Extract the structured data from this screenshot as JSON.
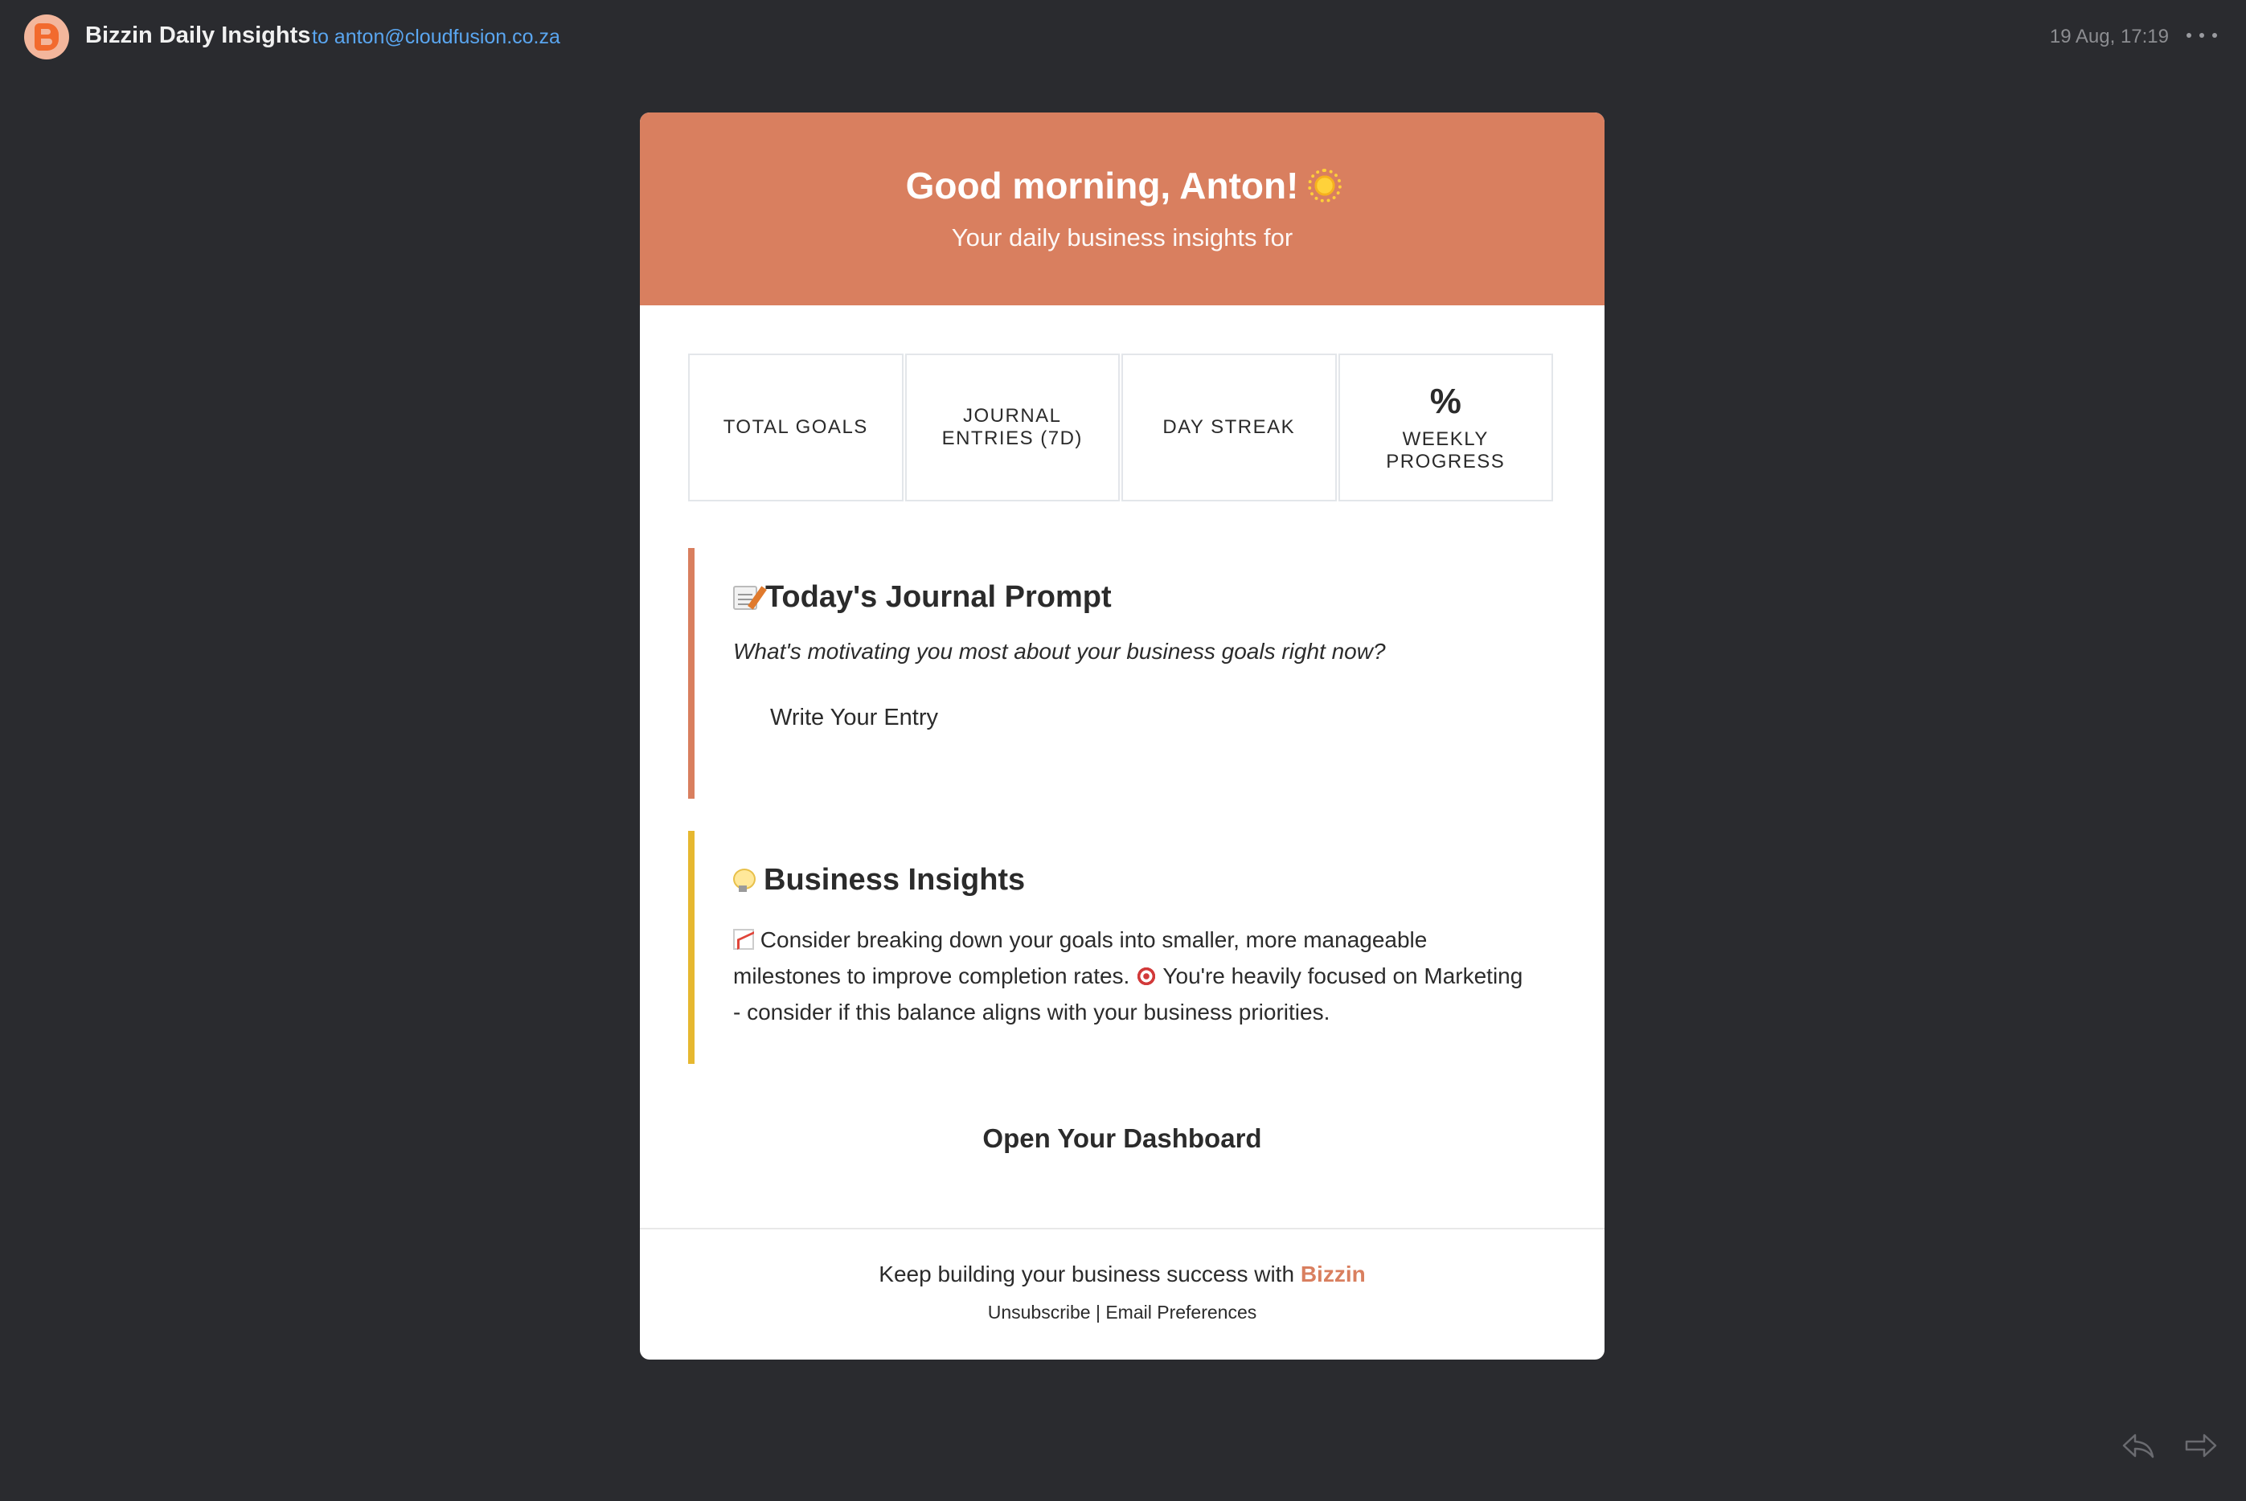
{
  "header": {
    "sender": "Bizzin Daily Insights",
    "recipient": "to anton@cloudfusion.co.za",
    "timestamp": "19 Aug, 17:19",
    "more_icon": "more-icon"
  },
  "email": {
    "greeting": "Good morning, Anton!",
    "subtitle": "Your daily business insights for",
    "stats": [
      {
        "value": "",
        "label": "TOTAL GOALS"
      },
      {
        "value": "",
        "label": "JOURNAL ENTRIES (7D)"
      },
      {
        "value": "",
        "label": "DAY STREAK"
      },
      {
        "value": "%",
        "label": "WEEKLY PROGRESS"
      }
    ],
    "journal": {
      "title": "Today's Journal Prompt",
      "prompt": "What's motivating you most about your business goals right now?",
      "button": "Write Your Entry"
    },
    "insights": {
      "title": "Business Insights",
      "text_part1": "Consider breaking down your goals into smaller, more manageable milestones to improve completion rates.",
      "text_part2": "You're heavily focused on Marketing - consider if this balance aligns with your business priorities."
    },
    "dashboard_button": "Open Your Dashboard",
    "footer": {
      "text": "Keep building your business success with",
      "brand": "Bizzin",
      "unsubscribe": "Unsubscribe",
      "separator": "|",
      "preferences": "Email Preferences"
    }
  },
  "colors": {
    "background": "#2a2b2f",
    "accent": "#d97f5f",
    "insight_border": "#e6b830",
    "link": "#5aa6f0"
  }
}
